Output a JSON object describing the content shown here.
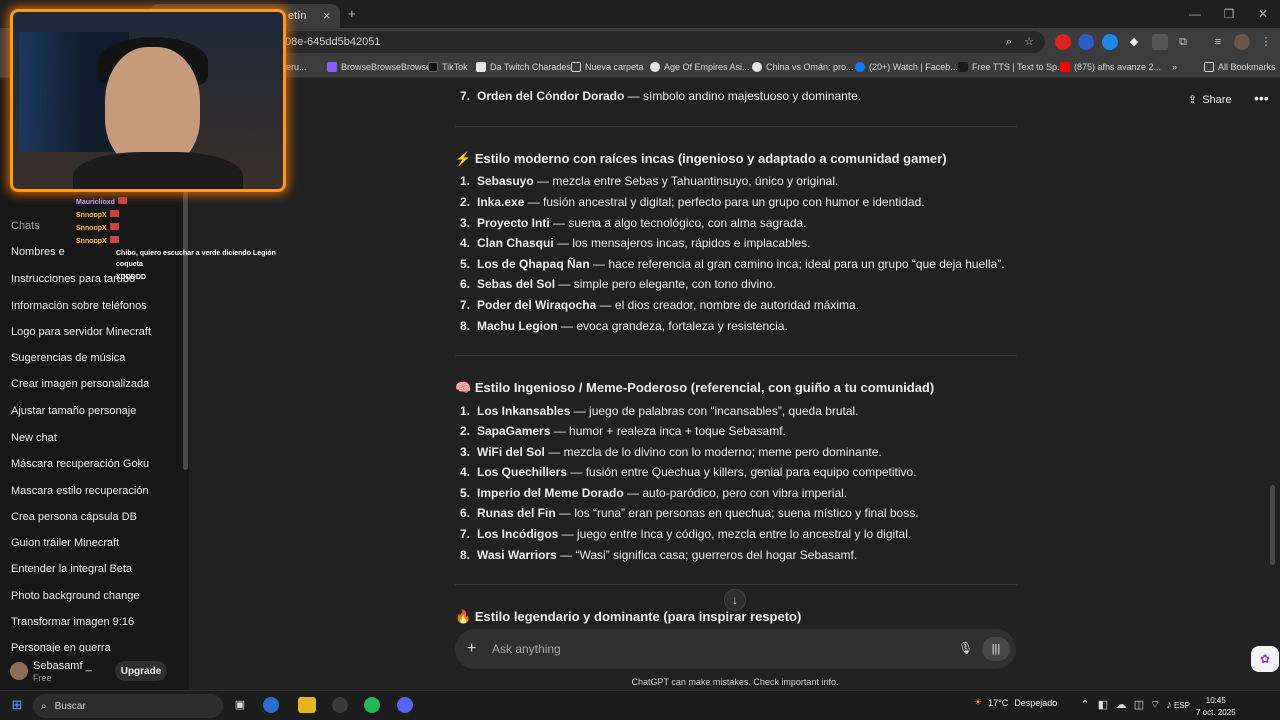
{
  "browser": {
    "tab_title": "etín",
    "new_tab": "+",
    "tab_close": "×",
    "url": "08e-645dd5b42051",
    "window_controls": [
      "—",
      "❐",
      "✕"
    ],
    "bookmarks": [
      {
        "label": "#peru...",
        "color": "#7a5cff"
      },
      {
        "label": "BrowseBrowseBrowse",
        "color": "#8b5cf6"
      },
      {
        "label": "TikTok",
        "color": "#111111"
      },
      {
        "label": "Da Twitch Charades",
        "color": "#e5e5e5"
      },
      {
        "label": "Nueva carpeta",
        "color": "#cfcfcf"
      },
      {
        "label": "Age Of Empires Asi...",
        "color": "#e5e5e5"
      },
      {
        "label": "China vs Omán: pro...",
        "color": "#e5e5e5"
      },
      {
        "label": "(20+) Watch | Faceb...",
        "color": "#1877f2"
      },
      {
        "label": "Free TTS | Text to Sp...",
        "color": "#1a1a1a"
      },
      {
        "label": "(875) afhs avanze 2...",
        "color": "#ff0000"
      }
    ],
    "all_bookmarks": "All Bookmarks"
  },
  "webcam_chat": [
    {
      "user": "Mauriclioxd",
      "color": "#c9a0ff",
      "text": ""
    },
    {
      "user": "SnnoopX",
      "color": "#ffb84d",
      "text": ""
    },
    {
      "user": "SnnoopX",
      "color": "#ffb84d",
      "text": ""
    },
    {
      "user": "SnnoopX",
      "color": "#ffb84d",
      "text": ""
    },
    {
      "user": "",
      "color": "#ffffff",
      "text": "Chibo, quiero escuchar a verde diciendo Legión"
    },
    {
      "user": "",
      "color": "#ffffff",
      "text": "coqueta"
    },
    {
      "user": "",
      "color": "#ffffff",
      "text": "XDDDDD"
    }
  ],
  "sidebar": {
    "chats_heading": "Chats",
    "items": [
      "Nombres e",
      "Instrucciones para tarubo",
      "Información sobre teléfonos",
      "Logo para servidor Minecraft",
      "Sugerencias de música",
      "Crear imagen personalizada",
      "Ajustar tamaño personaje",
      "New chat",
      "Máscara recuperación Goku",
      "Mascara estilo recuperación",
      "Crea persona cápsula DB",
      "Guion tráiler Minecraft",
      "Entender la integral Beta",
      "Photo background change",
      "Transformar imagen 9:16",
      "Personaje en guerra"
    ],
    "profile_name": "Sebasamf _",
    "profile_plan": "Free",
    "upgrade_label": "Upgrade"
  },
  "header": {
    "share_label": "Share",
    "more_label": "•••"
  },
  "content": {
    "top_item": {
      "n": "7.",
      "name": "Orden del Cóndor Dorado",
      "rest": " — símbolo andino majestuoso y dominante."
    },
    "sections": [
      {
        "icon": "⚡",
        "title": "Estilo moderno con raíces incas (ingenioso y adaptado a comunidad gamer)",
        "items": [
          {
            "n": "1.",
            "name": "Sebasuyo",
            "rest": " — mezcla entre Sebas y Tahuantinsuyo, único y original."
          },
          {
            "n": "2.",
            "name": "Inka.exe",
            "rest": " — fusión ancestral y digital; perfecto para un grupo con humor e identidad."
          },
          {
            "n": "3.",
            "name": "Proyecto Inti",
            "rest": " — suena a algo tecnológico, con alma sagrada."
          },
          {
            "n": "4.",
            "name": "Clan Chasqui",
            "rest": " — los mensajeros incas, rápidos e implacables."
          },
          {
            "n": "5.",
            "name": "Los de Qhapaq Ñan",
            "rest": " — hace referencia al gran camino inca; ideal para un grupo “que deja huella”."
          },
          {
            "n": "6.",
            "name": "Sebas del Sol",
            "rest": " — simple pero elegante, con tono divino."
          },
          {
            "n": "7.",
            "name": "Poder del Wiraqocha",
            "rest": " — el dios creador, nombre de autoridad máxima."
          },
          {
            "n": "8.",
            "name": "Machu Legion",
            "rest": " — evoca grandeza, fortaleza y resistencia."
          }
        ]
      },
      {
        "icon": "🧠",
        "title": "Estilo Ingenioso / Meme-Poderoso (referencial, con guiño a tu comunidad)",
        "items": [
          {
            "n": "1.",
            "name": "Los Inkansables",
            "rest": " — juego de palabras con “incansables”, queda brutal."
          },
          {
            "n": "2.",
            "name": "SapaGamers",
            "rest": " — humor + realeza inca + toque Sebasamf."
          },
          {
            "n": "3.",
            "name": "WiFi del Sol",
            "rest": " — mezcla de lo divino con lo moderno; meme pero dominante."
          },
          {
            "n": "4.",
            "name": "Los Quechillers",
            "rest": " — fusión entre Quechua y killers, genial para equipo competitivo."
          },
          {
            "n": "5.",
            "name": "Imperio del Meme Dorado",
            "rest": " — auto-paródico, pero con vibra imperial."
          },
          {
            "n": "6.",
            "name": "Runas del Fin",
            "rest": " — los “runa” eran personas en quechua; suena místico y final boss."
          },
          {
            "n": "7.",
            "name": "Los Incódigos",
            "rest": " — juego entre Inca y código, mezcla entre lo ancestral y lo digital."
          },
          {
            "n": "8.",
            "name": "Wasi Warriors",
            "rest": " — “Wasi” significa casa; guerreros del hogar Sebasamf."
          }
        ]
      },
      {
        "icon": "🔥",
        "title": "Estilo legendario y dominante (para inspirar respeto)",
        "items": []
      }
    ]
  },
  "composer": {
    "placeholder": "Ask anything",
    "plus": "+",
    "mic": "🎙",
    "voice": "|||",
    "scroll_down": "↓",
    "disclaimer": "ChatGPT can make mistakes. Check important info."
  },
  "taskbar": {
    "search_label": "Buscar",
    "temperature": "17°C",
    "weather": "Despejado",
    "language": "ESP",
    "time": "10:45",
    "date": "7 oct. 2025"
  }
}
